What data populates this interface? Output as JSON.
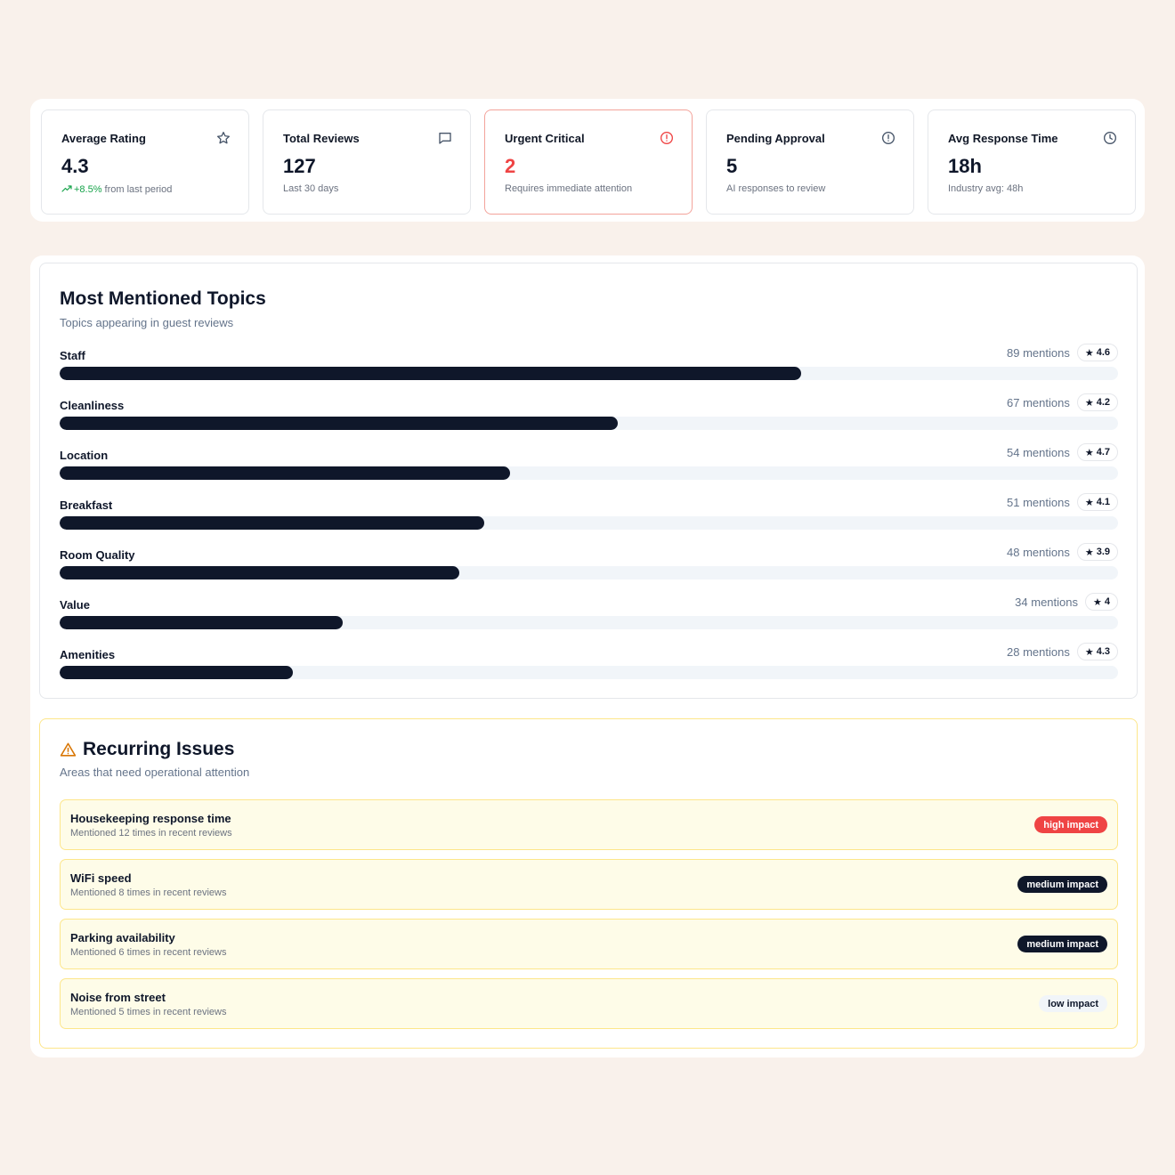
{
  "stats": [
    {
      "title": "Average Rating",
      "value": "4.3",
      "trend": "+8.5%",
      "sub": " from last period",
      "icon": "star-icon"
    },
    {
      "title": "Total Reviews",
      "value": "127",
      "sub": "Last 30 days",
      "icon": "message-icon"
    },
    {
      "title": "Urgent Critical",
      "value": "2",
      "sub": "Requires immediate attention",
      "icon": "alert-circle-icon"
    },
    {
      "title": "Pending Approval",
      "value": "5",
      "sub": "AI responses to review",
      "icon": "info-circle-icon"
    },
    {
      "title": "Avg Response Time",
      "value": "18h",
      "sub": "Industry avg: 48h",
      "icon": "clock-icon"
    }
  ],
  "topics": {
    "title": "Most Mentioned Topics",
    "subtitle": "Topics appearing in guest reviews",
    "max_mentions": 127,
    "items": [
      {
        "name": "Staff",
        "mentions": 89,
        "mentions_label": "89 mentions",
        "rating": "4.6"
      },
      {
        "name": "Cleanliness",
        "mentions": 67,
        "mentions_label": "67 mentions",
        "rating": "4.2"
      },
      {
        "name": "Location",
        "mentions": 54,
        "mentions_label": "54 mentions",
        "rating": "4.7"
      },
      {
        "name": "Breakfast",
        "mentions": 51,
        "mentions_label": "51 mentions",
        "rating": "4.1"
      },
      {
        "name": "Room Quality",
        "mentions": 48,
        "mentions_label": "48 mentions",
        "rating": "3.9"
      },
      {
        "name": "Value",
        "mentions": 34,
        "mentions_label": "34 mentions",
        "rating": "4"
      },
      {
        "name": "Amenities",
        "mentions": 28,
        "mentions_label": "28 mentions",
        "rating": "4.3"
      }
    ]
  },
  "issues": {
    "title": "Recurring Issues",
    "subtitle": "Areas that need operational attention",
    "items": [
      {
        "name": "Housekeeping response time",
        "sub": "Mentioned 12 times in recent reviews",
        "impact": "high impact",
        "level": "high"
      },
      {
        "name": "WiFi speed",
        "sub": "Mentioned 8 times in recent reviews",
        "impact": "medium impact",
        "level": "medium"
      },
      {
        "name": "Parking availability",
        "sub": "Mentioned 6 times in recent reviews",
        "impact": "medium impact",
        "level": "medium"
      },
      {
        "name": "Noise from street",
        "sub": "Mentioned 5 times in recent reviews",
        "impact": "low impact",
        "level": "low"
      }
    ]
  },
  "colors": {
    "background": "#f9f1eb",
    "bar": "#0f172a",
    "trend": "#16a34a",
    "urgent": "#ef4444",
    "warning": "#d97706"
  }
}
